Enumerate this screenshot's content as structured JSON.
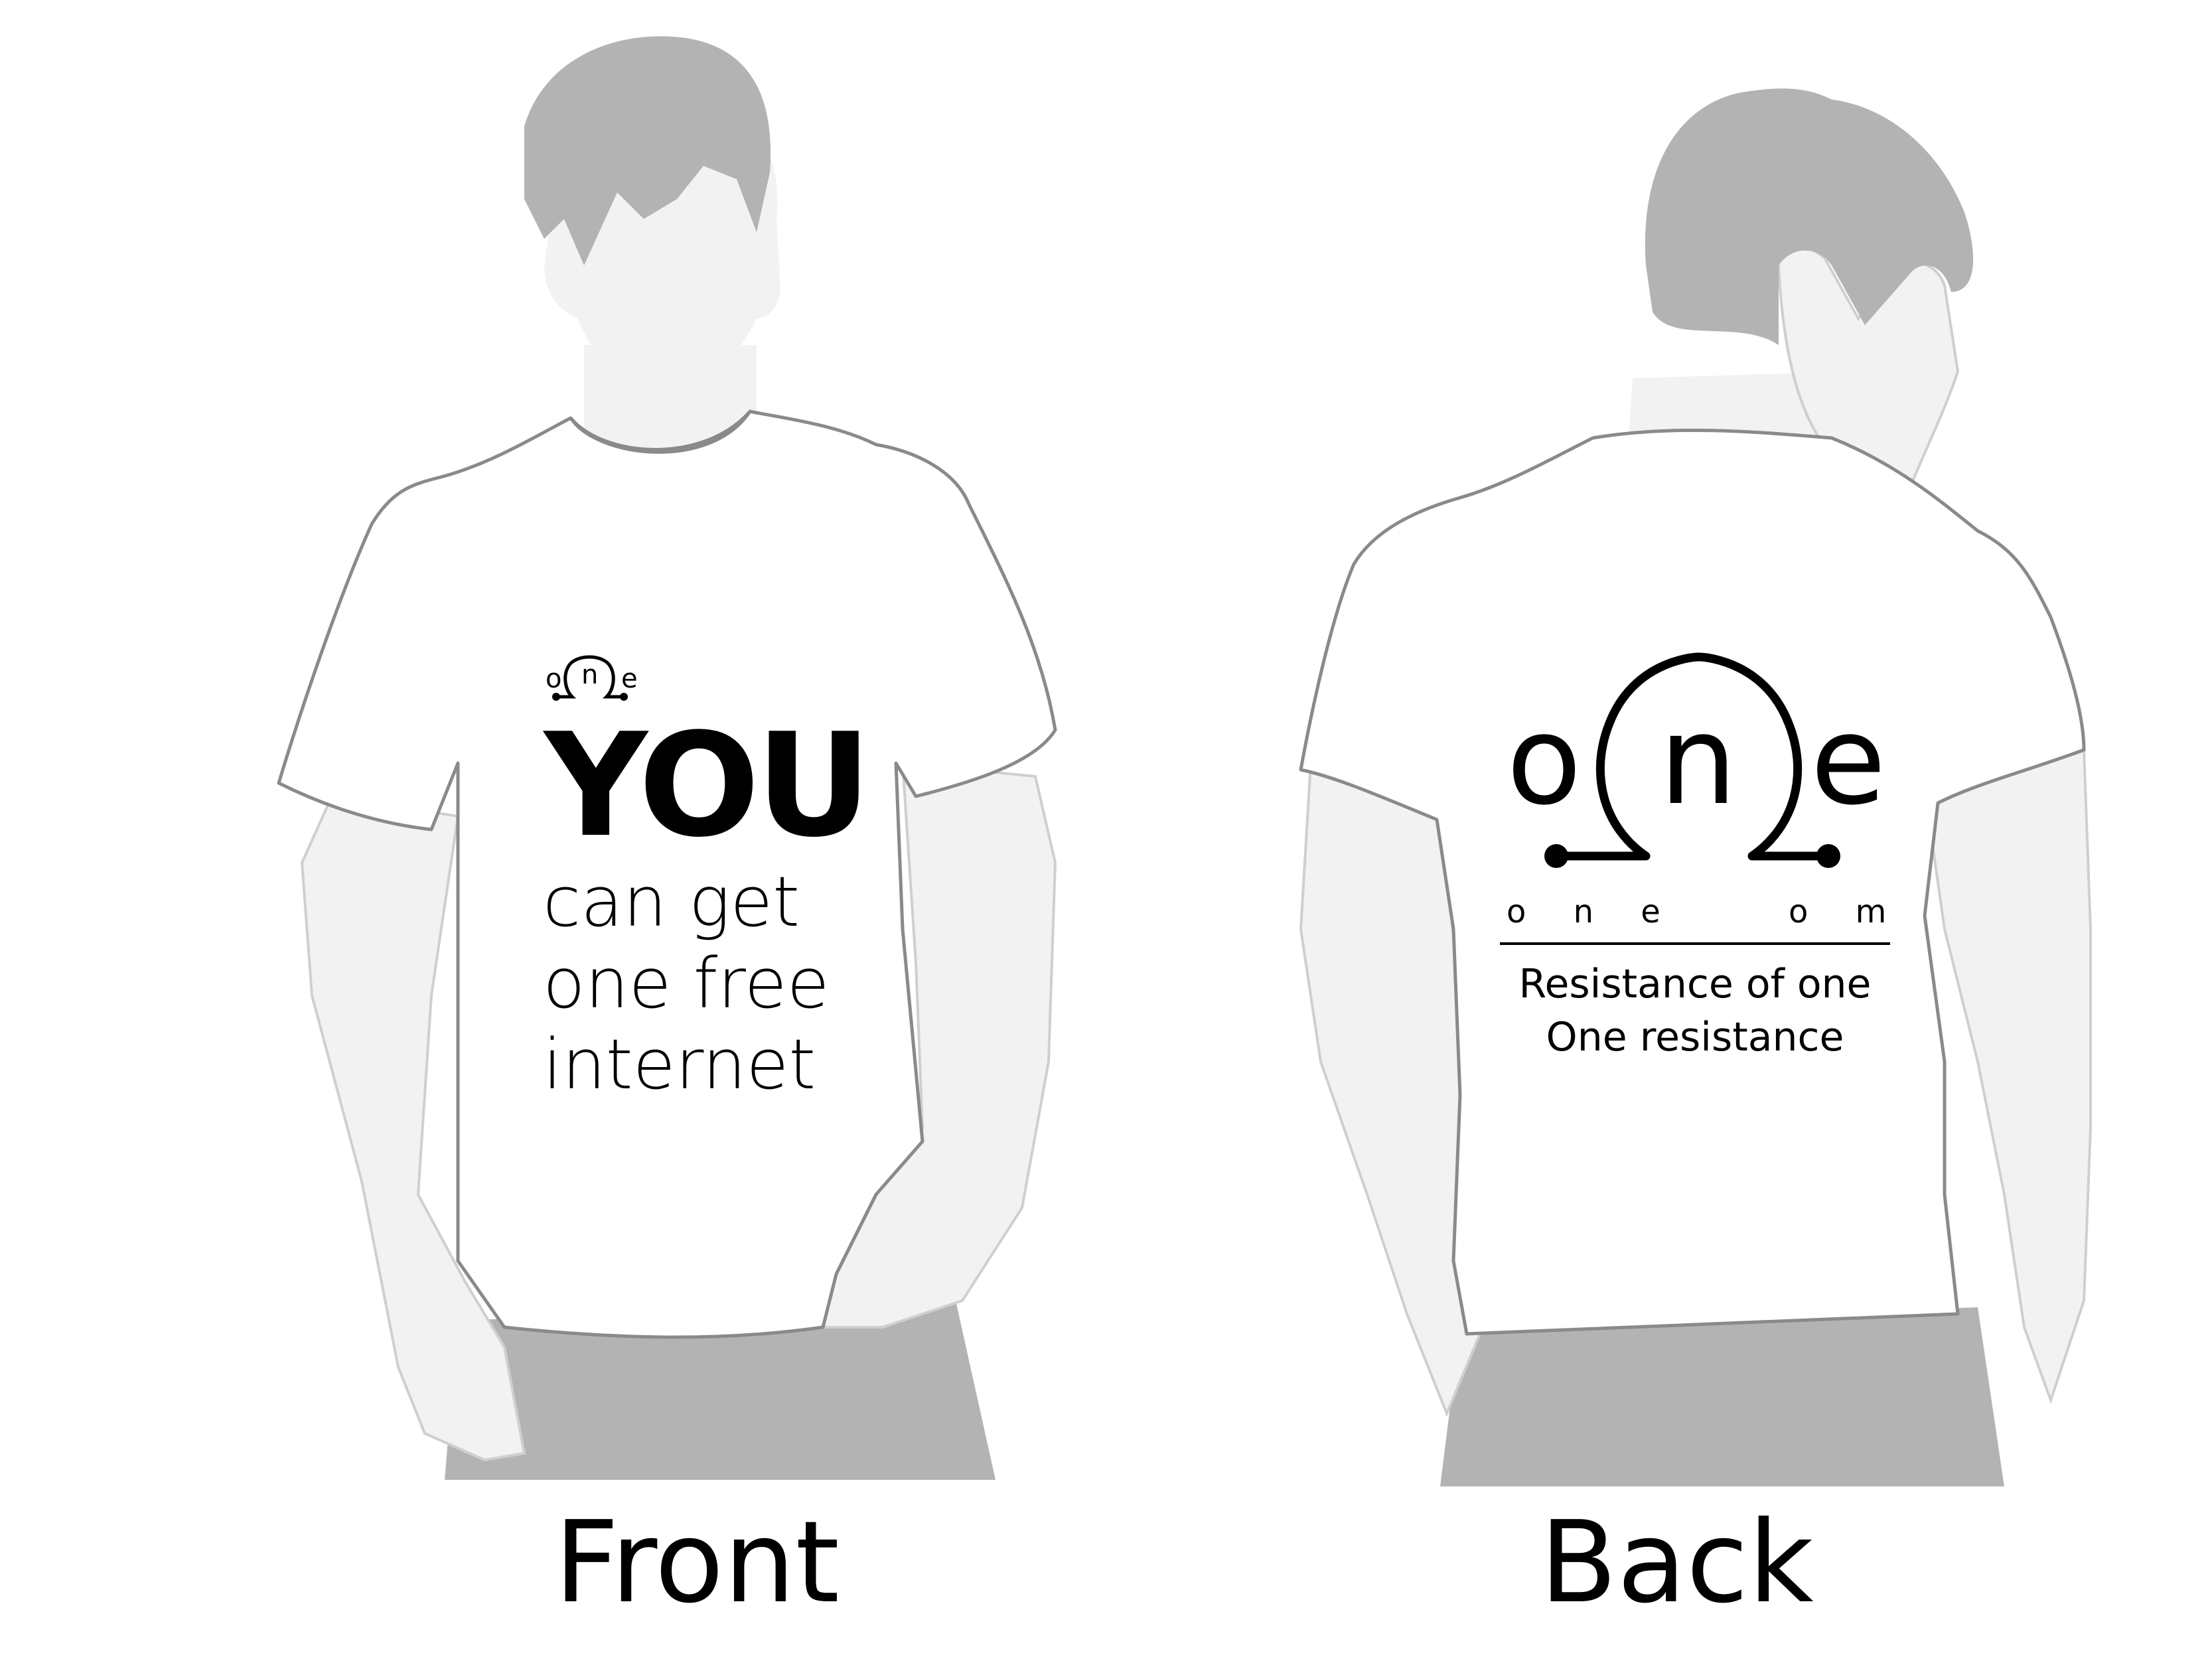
{
  "front": {
    "caption": "Front",
    "logo": {
      "letters": [
        "o",
        "n",
        "e"
      ]
    },
    "headline": "YOU",
    "lines": [
      "can get",
      "one free",
      "internet"
    ]
  },
  "back": {
    "caption": "Back",
    "logo": {
      "letters": [
        "o",
        "n",
        "e"
      ]
    },
    "subtitle_left": "o n e",
    "subtitle_right": "o m",
    "tagline_1": "Resistance of one",
    "tagline_2": "One resistance"
  },
  "colors": {
    "silhouette": "#f2f2f2",
    "hair_pants": "#b3b3b3",
    "outline": "#8a8a8a",
    "shirt": "#ffffff",
    "ink": "#000000"
  }
}
